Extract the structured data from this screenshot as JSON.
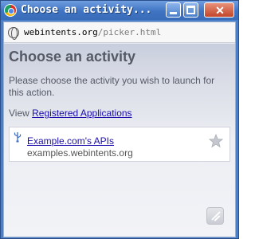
{
  "window": {
    "title": "Choose an activity...",
    "minimize_icon": "minimize-icon",
    "maximize_icon": "maximize-icon",
    "close_icon": "close-icon",
    "close_glyph": "✕"
  },
  "address_bar": {
    "host": "webintents.org",
    "path": "/picker.html",
    "icon": "globe-icon"
  },
  "page": {
    "heading": "Choose an activity",
    "description": "Please choose the activity you wish to launch for this action.",
    "view_prefix": "View ",
    "registered_link": "Registered Applications"
  },
  "services": [
    {
      "name": "Example.com's APIs",
      "domain": "examples.webintents.org",
      "icon": "usb-icon",
      "star": "☆"
    }
  ],
  "colors": {
    "titlebar": "#3f74c3",
    "link": "#1a0dab",
    "heading": "#555a66"
  }
}
